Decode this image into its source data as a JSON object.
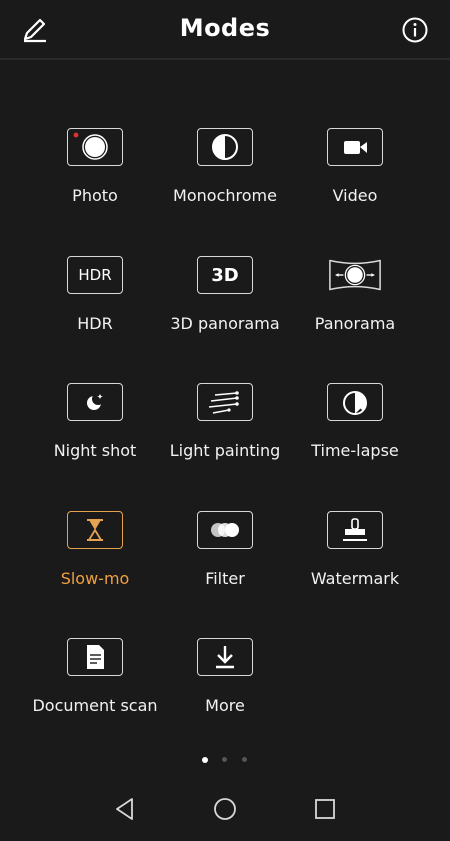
{
  "header": {
    "title": "Modes",
    "edit_icon": "pencil-icon",
    "info_icon": "info-icon"
  },
  "modes": [
    {
      "label": "Photo",
      "icon": "photo-icon"
    },
    {
      "label": "Monochrome",
      "icon": "monochrome-icon"
    },
    {
      "label": "Video",
      "icon": "video-icon"
    },
    {
      "label": "HDR",
      "icon": "hdr-icon",
      "icon_text": "HDR"
    },
    {
      "label": "3D panorama",
      "icon": "3d-panorama-icon",
      "icon_text": "3D"
    },
    {
      "label": "Panorama",
      "icon": "panorama-icon"
    },
    {
      "label": "Night shot",
      "icon": "night-shot-icon"
    },
    {
      "label": "Light painting",
      "icon": "light-painting-icon"
    },
    {
      "label": "Time-lapse",
      "icon": "time-lapse-icon"
    },
    {
      "label": "Slow-mo",
      "icon": "slow-mo-icon",
      "active": true
    },
    {
      "label": "Filter",
      "icon": "filter-icon"
    },
    {
      "label": "Watermark",
      "icon": "watermark-icon"
    },
    {
      "label": "Document scan",
      "icon": "document-scan-icon"
    },
    {
      "label": "More",
      "icon": "download-icon"
    }
  ],
  "pager": {
    "pages": 3,
    "current": 1
  },
  "colors": {
    "background": "#1a1a1a",
    "accent": "#f0a040",
    "icon_border": "#d8d8d8",
    "text": "#f2f2f2"
  },
  "nav": [
    "back-icon",
    "home-icon",
    "recents-icon"
  ]
}
